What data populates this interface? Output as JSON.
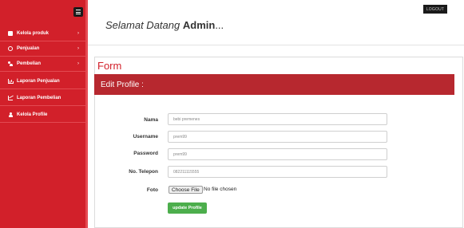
{
  "sidebar": {
    "items": [
      {
        "label": "Kelola produk",
        "icon": "box-icon"
      },
      {
        "label": "Penjualan",
        "icon": "tag-icon"
      },
      {
        "label": "Pembelian",
        "icon": "users-icon"
      },
      {
        "label": "Laporan Penjualan",
        "icon": "bar-chart-icon"
      },
      {
        "label": "Laporan Pembelian",
        "icon": "line-chart-icon"
      },
      {
        "label": "Kelola Profile",
        "icon": "person-icon"
      }
    ],
    "chevron": "›"
  },
  "header": {
    "greeting": "Selamat Datang",
    "user": "Admin",
    "ellipsis": "...",
    "logout_label": "LOGOUT"
  },
  "form": {
    "title": "Form",
    "panel_title": "Edit Profile :",
    "fields": {
      "nama": {
        "label": "Nama",
        "value": "bebi premenes"
      },
      "username": {
        "label": "Username",
        "value": "prem99"
      },
      "password": {
        "label": "Password",
        "value": "prem99"
      },
      "telepon": {
        "label": "No. Telepon",
        "value": "082211115555"
      },
      "foto": {
        "label": "Foto",
        "button": "Choose File",
        "status": "No file chosen"
      }
    },
    "submit_label": "update Profile"
  },
  "colors": {
    "sidebar": "#d2202a",
    "panel_header": "#b7282f",
    "title": "#d2202a",
    "submit": "#4cae4c"
  }
}
